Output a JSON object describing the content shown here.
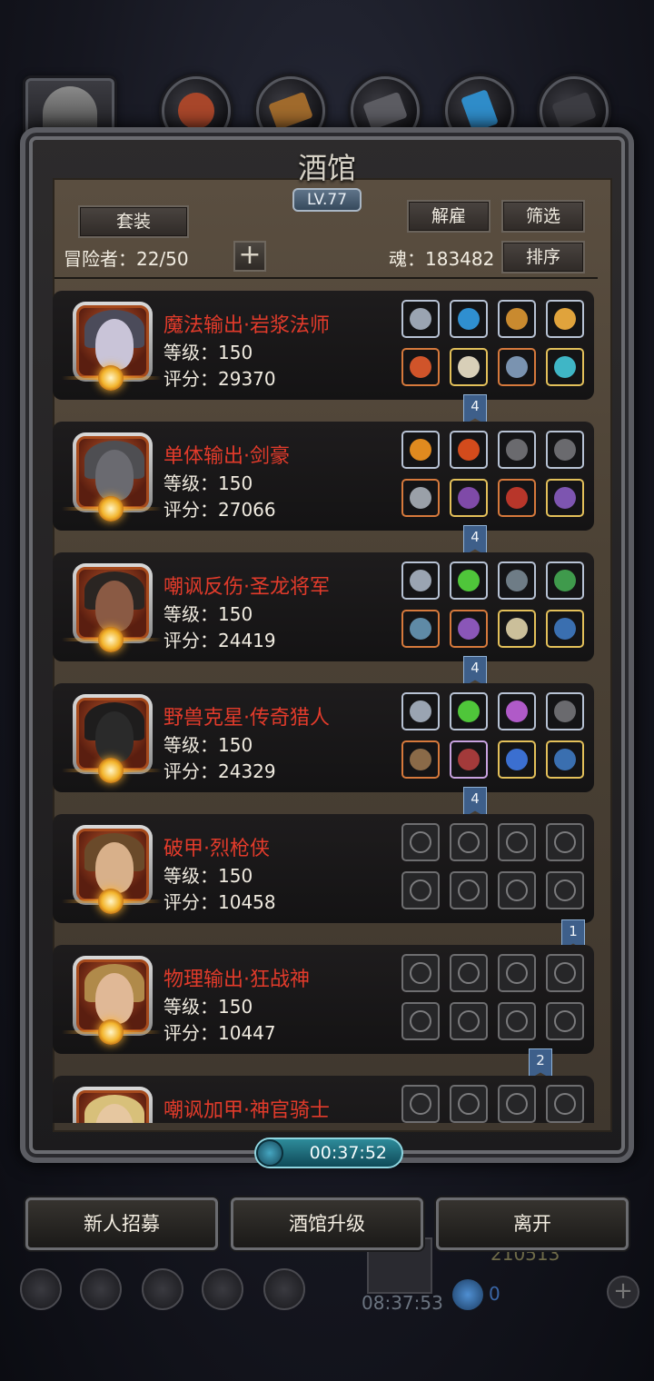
{
  "window": {
    "title": "酒馆",
    "level": "LV.77"
  },
  "header": {
    "suit_button": "套装",
    "dismiss_button": "解雇",
    "filter_button": "筛选",
    "sort_button": "排序",
    "adventurers_label": "冒险者：22/50",
    "soul_label": "魂：183482",
    "add_symbol": "+"
  },
  "adventurers": [
    {
      "role": "魔法输出·岩浆法师",
      "level": "等级：150",
      "score": "评分：29370",
      "flag": "4"
    },
    {
      "role": "单体输出·剑豪",
      "level": "等级：150",
      "score": "评分：27066",
      "flag": "4"
    },
    {
      "role": "嘲讽反伤·圣龙将军",
      "level": "等级：150",
      "score": "评分：24419",
      "flag": "4"
    },
    {
      "role": "野兽克星·传奇猎人",
      "level": "等级：150",
      "score": "评分：24329",
      "flag": "4"
    },
    {
      "role": "破甲·烈枪侠",
      "level": "等级：150",
      "score": "评分：10458",
      "flag": "1"
    },
    {
      "role": "物理输出·狂战神",
      "level": "等级：150",
      "score": "评分：10447",
      "flag": "2"
    },
    {
      "role": "嘲讽加甲·神官骑士",
      "level": "",
      "score": "",
      "flag": ""
    }
  ],
  "timer": "00:37:52",
  "buttons": {
    "recruit": "新人招募",
    "upgrade": "酒馆升级",
    "leave": "离开"
  },
  "background": {
    "timer": "08:37:53",
    "gold": "210513",
    "gems": "0"
  },
  "colors": {
    "role_name": "#e23b2b",
    "flag": "#3e5f8a",
    "timer": "#2e8b9a"
  }
}
